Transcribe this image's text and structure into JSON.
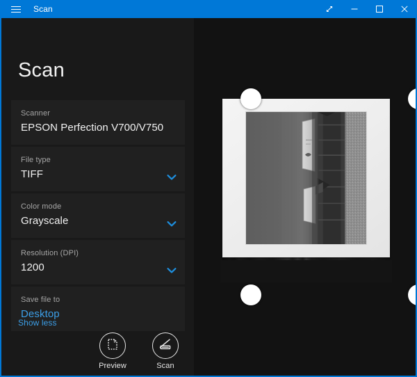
{
  "window": {
    "app_title": "Scan",
    "accent_color": "#0078d7",
    "menu_icon": "hamburger-icon",
    "controls": [
      {
        "name": "fullscreen",
        "icon": "diagonal-arrow-icon",
        "label": "Full screen"
      },
      {
        "name": "minimize",
        "icon": "minimize-icon",
        "label": "Minimize"
      },
      {
        "name": "maximize",
        "icon": "maximize-icon",
        "label": "Maximize"
      },
      {
        "name": "close",
        "icon": "close-icon",
        "label": "Close"
      }
    ]
  },
  "sidebar": {
    "heading": "Scan",
    "fields": [
      {
        "label": "Scanner",
        "value": "EPSON Perfection V700/V750",
        "has_chevron": false,
        "is_link": false
      },
      {
        "label": "File type",
        "value": "TIFF",
        "has_chevron": true,
        "is_link": false
      },
      {
        "label": "Color mode",
        "value": "Grayscale",
        "has_chevron": true,
        "is_link": false
      },
      {
        "label": "Resolution (DPI)",
        "value": "1200",
        "has_chevron": true,
        "is_link": false
      },
      {
        "label": "Save file to",
        "value": "Desktop",
        "has_chevron": false,
        "is_link": true
      }
    ],
    "show_less_label": "Show less",
    "link_color": "#3c9fe8",
    "actions": [
      {
        "label": "Preview",
        "icon": "preview-page-icon"
      },
      {
        "label": "Scan",
        "icon": "scanner-icon"
      }
    ]
  },
  "preview": {
    "name": "scan-preview",
    "description": "Scanned grayscale photograph with white border on scanner bed",
    "crop_handles": [
      "top-left",
      "top-right",
      "bottom-left",
      "bottom-right"
    ],
    "background_color": "#121212"
  }
}
